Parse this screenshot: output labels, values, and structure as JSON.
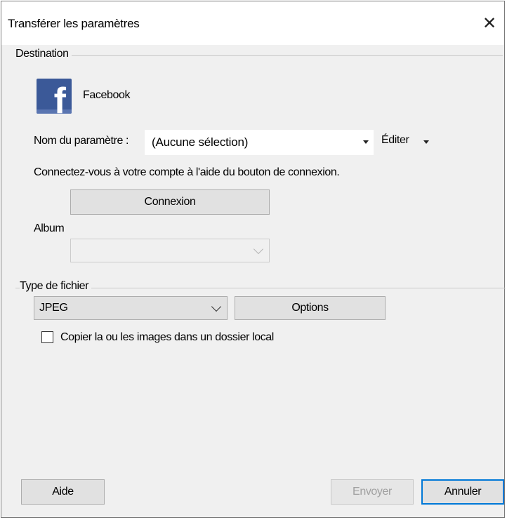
{
  "window": {
    "title": "Transférer les paramètres",
    "close_glyph": "✕"
  },
  "destination": {
    "group_label": "Destination",
    "service_icon": "facebook-logo",
    "service_name": "Facebook",
    "setting_name_label": "Nom du paramètre :",
    "setting_name_value": "(Aucune sélection)",
    "edit_label": "Éditer",
    "connect_hint": "Connectez-vous à votre compte à l'aide du bouton de connexion.",
    "connect_button": "Connexion",
    "album_label": "Album",
    "album_value": ""
  },
  "file_type": {
    "group_label": "Type de fichier",
    "selected": "JPEG",
    "options_button": "Options",
    "copy_local_label": "Copier la ou les images dans un dossier local",
    "copy_local_checked": false
  },
  "footer": {
    "help_button": "Aide",
    "send_button": "Envoyer",
    "cancel_button": "Annuler"
  },
  "colors": {
    "facebook_blue": "#3b5998",
    "default_button_border": "#0078d7"
  }
}
